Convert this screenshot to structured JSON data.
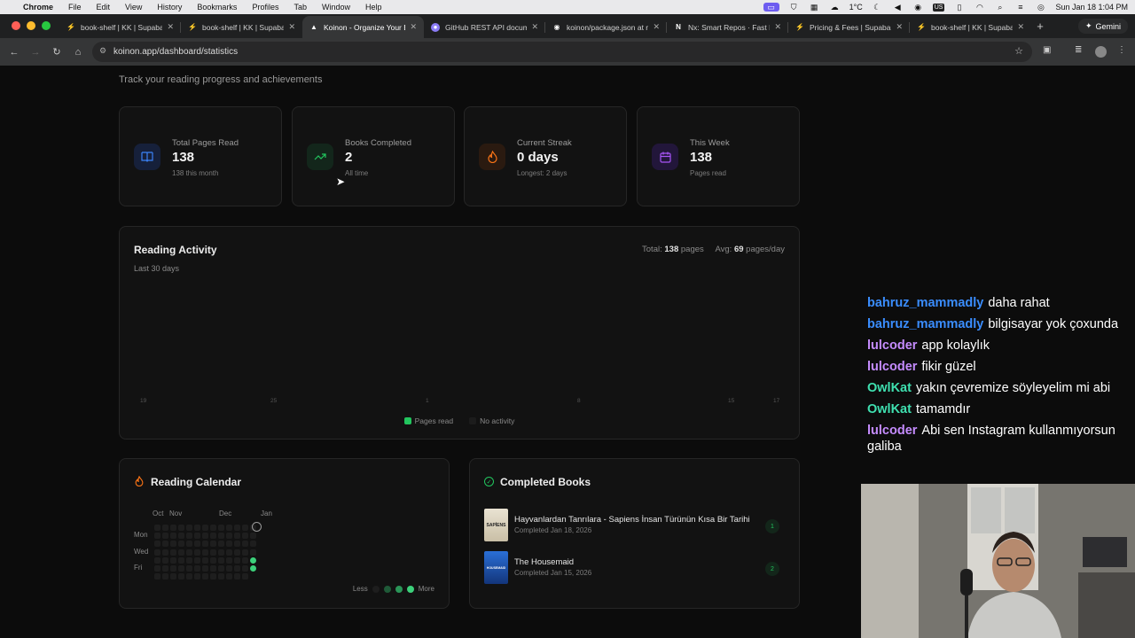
{
  "menubar": {
    "app": "Chrome",
    "items": [
      "File",
      "Edit",
      "View",
      "History",
      "Bookmarks",
      "Profiles",
      "Tab",
      "Window",
      "Help"
    ],
    "temp": "1°C",
    "input": "US",
    "clock": "Sun Jan 18  1:04 PM"
  },
  "tabs": [
    {
      "title": "book-shelf | KK | Supabase",
      "icon": "supabase-icon"
    },
    {
      "title": "book-shelf | KK | Supabase",
      "icon": "supabase-icon"
    },
    {
      "title": "Koinon - Organize Your Books",
      "icon": "koinon-icon",
      "active": true
    },
    {
      "title": "GitHub REST API documentation",
      "icon": "github-docs-icon"
    },
    {
      "title": "koinon/package.json at main",
      "icon": "github-icon"
    },
    {
      "title": "Nx: Smart Repos · Fast Builds",
      "icon": "nx-icon"
    },
    {
      "title": "Pricing & Fees | Supabase",
      "icon": "supabase-icon"
    },
    {
      "title": "book-shelf | KK | Supabase",
      "icon": "supabase-icon"
    }
  ],
  "gemini_label": "Gemini",
  "url": "koinon.app/dashboard/statistics",
  "page": {
    "subtitle": "Track your reading progress and achievements",
    "stats": [
      {
        "label": "Total Pages Read",
        "value": "138",
        "sub": "138 this month",
        "icon": "book-icon",
        "color": "#3b82f6"
      },
      {
        "label": "Books Completed",
        "value": "2",
        "sub": "All time",
        "icon": "trending-up-icon",
        "color": "#22c55e"
      },
      {
        "label": "Current Streak",
        "value": "0 days",
        "sub": "Longest: 2 days",
        "icon": "flame-icon",
        "color": "#f97316"
      },
      {
        "label": "This Week",
        "value": "138",
        "sub": "Pages read",
        "icon": "calendar-icon",
        "color": "#a855f7"
      }
    ],
    "activity": {
      "title": "Reading Activity",
      "subtitle": "Last 30 days",
      "total_label": "Total:",
      "total_value": "138",
      "total_unit": "pages",
      "avg_label": "Avg:",
      "avg_value": "69",
      "avg_unit": "pages/day",
      "ticks": [
        "19",
        "25",
        "1",
        "8",
        "15",
        "17"
      ],
      "legend_read": "Pages read",
      "legend_none": "No activity"
    },
    "calendar": {
      "title": "Reading Calendar",
      "months": [
        "Oct",
        "Nov",
        "Dec",
        "Jan"
      ],
      "days": [
        "Mon",
        "Wed",
        "Fri"
      ],
      "less": "Less",
      "more": "More"
    },
    "completed": {
      "title": "Completed Books",
      "books": [
        {
          "title": "Hayvanlardan Tanrılara - Sapiens İnsan Türünün Kısa Bir Tarihi",
          "date": "Completed Jan 18, 2026",
          "rank": "1",
          "cover_text": "SAPİENS"
        },
        {
          "title": "The Housemaid",
          "date": "Completed Jan 15, 2026",
          "rank": "2",
          "cover_text": "HOUSEMAID"
        }
      ]
    }
  },
  "chat": [
    {
      "user": "bahruz_mammadly",
      "color": "#3a8dff",
      "text": "daha rahat"
    },
    {
      "user": "bahruz_mammadly",
      "color": "#3a8dff",
      "text": "bilgisayar yok çoxunda"
    },
    {
      "user": "lulcoder",
      "color": "#c58cff",
      "text": "app kolaylık"
    },
    {
      "user": "lulcoder",
      "color": "#c58cff",
      "text": "fikir güzel"
    },
    {
      "user": "OwlKat",
      "color": "#3fe0b0",
      "text": "yakın çevremize söyleyelim mi abi"
    },
    {
      "user": "OwlKat",
      "color": "#3fe0b0",
      "text": "tamamdır"
    },
    {
      "user": "lulcoder",
      "color": "#c58cff",
      "text": "Abi sen Instagram kullanmıyorsun galiba"
    }
  ]
}
